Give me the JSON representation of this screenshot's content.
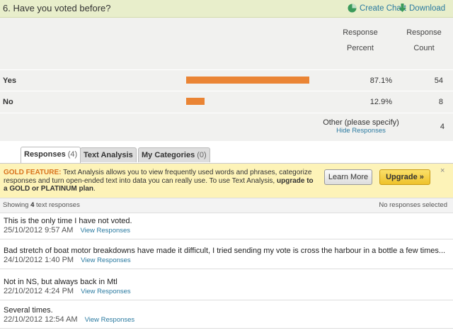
{
  "question": {
    "title": "6. Have you voted before?",
    "create_chart": "Create Chart",
    "download": "Download"
  },
  "columns": {
    "response_percent_1": "Response",
    "response_percent_2": "Percent",
    "response_count_1": "Response",
    "response_count_2": "Count"
  },
  "answers": [
    {
      "label": "Yes",
      "percent_text": "87.1%",
      "percent": 87.1,
      "count": "54"
    },
    {
      "label": "No",
      "percent_text": "12.9%",
      "percent": 12.9,
      "count": "8"
    }
  ],
  "other": {
    "label": "Other (please specify)",
    "hide": "Hide Responses",
    "count": "4"
  },
  "tabs": [
    {
      "label": "Responses",
      "count": "(4)"
    },
    {
      "label": "Text Analysis",
      "count": ""
    },
    {
      "label": "My Categories",
      "count": "(0)"
    }
  ],
  "gold": {
    "tag": "GOLD FEATURE:",
    "text1": " Text Analysis allows you to view frequently used words and phrases, categorize responses and turn open-ended text into data you can really use. To use Text Analysis, ",
    "text2": "upgrade to a GOLD or PLATINUM plan",
    "text3": ".",
    "learn_more": "Learn More",
    "upgrade": "Upgrade »",
    "close": "×"
  },
  "showing": {
    "pre": "Showing ",
    "count": "4",
    "post": " text responses",
    "selected": "No responses selected"
  },
  "responses": [
    {
      "text": "This is the only time I have not voted.",
      "date": "25/10/2012 9:57 AM",
      "link": "View Responses"
    },
    {
      "text": "Bad stretch of boat motor breakdowns have made it difficult, I tried sending my vote is cross the harbour in a bottle a few times...",
      "date": "24/10/2012 1:40 PM",
      "link": "View Responses"
    },
    {
      "text": "Not in NS, but always back in Mtl",
      "date": "22/10/2012 4:24 PM",
      "link": "View Responses"
    },
    {
      "text": "Several times.",
      "date": "22/10/2012 12:54 AM",
      "link": "View Responses"
    }
  ],
  "colors": {
    "bar": "#ea8434",
    "link": "#2a7aa0",
    "gold_tag": "#d9721c"
  }
}
